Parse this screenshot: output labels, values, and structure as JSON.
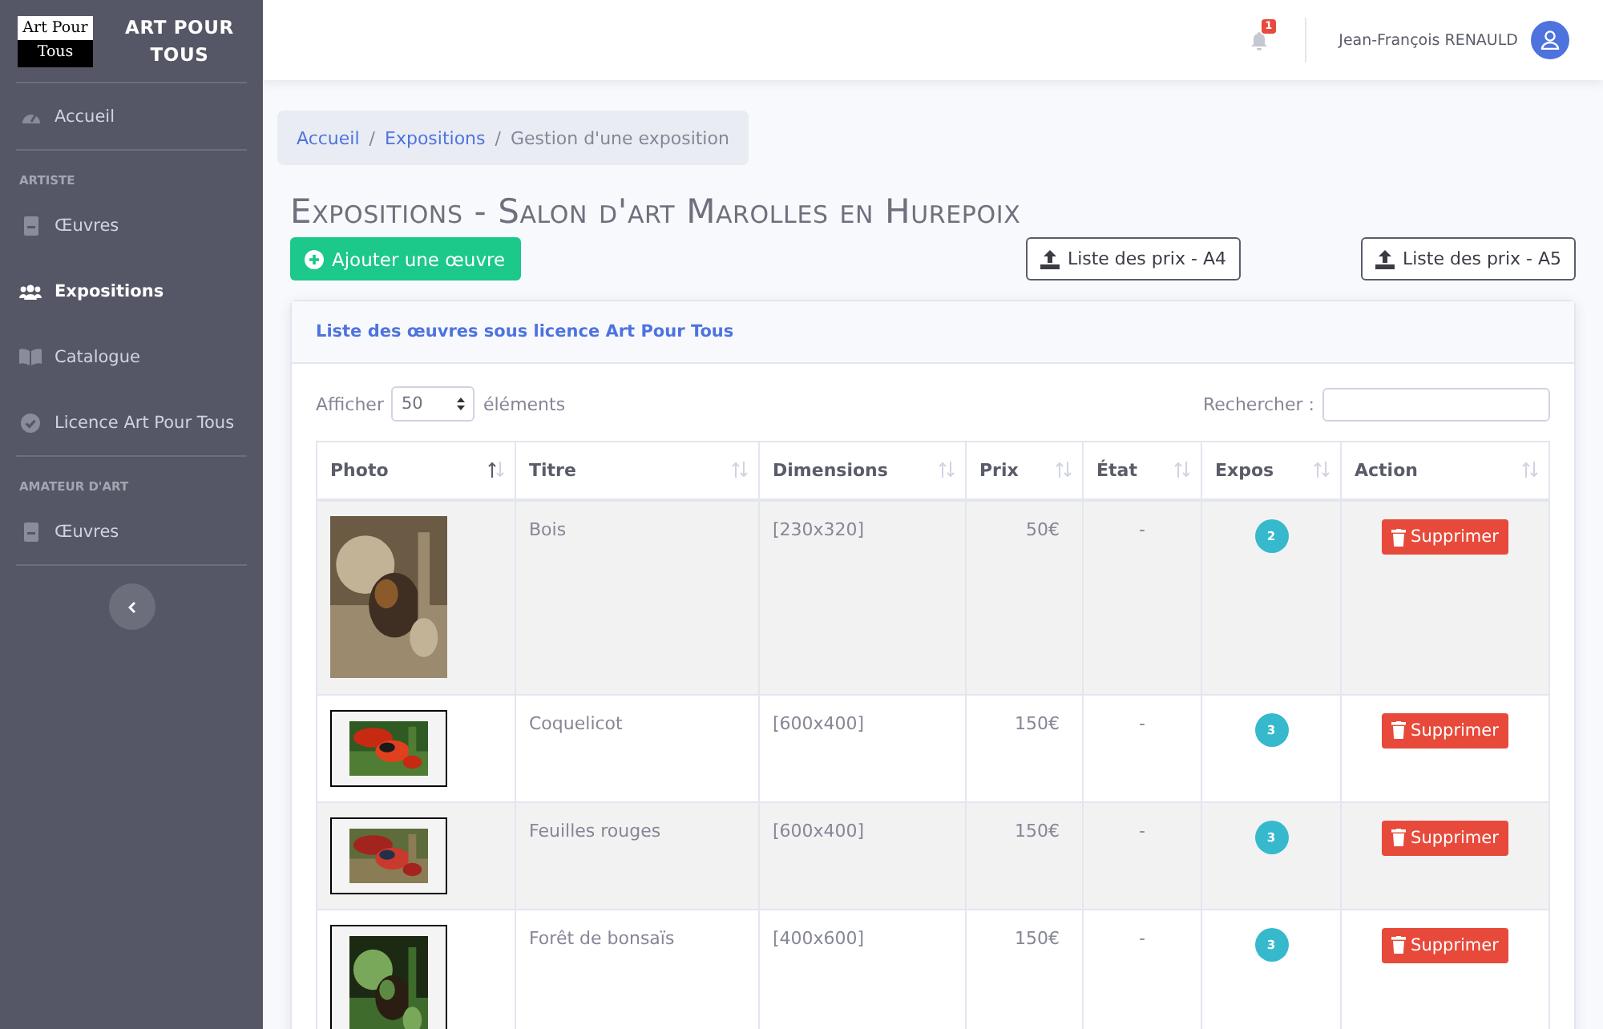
{
  "sidebar": {
    "logo_lines": [
      "Art Pour",
      "Tous"
    ],
    "brand": "ART POUR TOUS",
    "items": [
      {
        "kind": "divider"
      },
      {
        "kind": "link",
        "label": "Accueil",
        "selected": false
      },
      {
        "kind": "divider"
      },
      {
        "kind": "heading",
        "label": "ARTISTE"
      },
      {
        "kind": "link",
        "label": "Œuvres",
        "selected": false
      },
      {
        "kind": "link",
        "label": "Expositions",
        "selected": true
      },
      {
        "kind": "link",
        "label": "Catalogue",
        "selected": false
      },
      {
        "kind": "link",
        "label": "Licence Art Pour Tous",
        "selected": false
      },
      {
        "kind": "divider"
      },
      {
        "kind": "heading",
        "label": "AMATEUR D'ART"
      },
      {
        "kind": "link",
        "label": "Œuvres",
        "selected": false
      },
      {
        "kind": "divider"
      }
    ]
  },
  "topbar": {
    "notification_count": "1",
    "user_name": "Jean-François RENAULD"
  },
  "breadcrumb": [
    {
      "kind": "link",
      "label": "Accueil"
    },
    {
      "kind": "separator",
      "label": "/"
    },
    {
      "kind": "link",
      "label": "Expositions"
    },
    {
      "kind": "separator",
      "label": "/"
    },
    {
      "kind": "current",
      "label": "Gestion d'une exposition"
    }
  ],
  "page_title": "Expositions - Salon d'art Marolles en Hurepoix",
  "actions": {
    "add": "Ajouter une œuvre",
    "exports": [
      "Liste des prix - A4",
      "Liste des prix - A5"
    ]
  },
  "card": {
    "title": "Liste des œuvres sous licence Art Pour Tous",
    "show_label": "Afficher",
    "page_size": "50",
    "show_suffix": "éléments",
    "search_label": "Rechercher :",
    "columns": [
      "Photo",
      "Titre",
      "Dimensions",
      "Prix",
      "État",
      "Expos",
      "Action"
    ],
    "rows": [
      {
        "photo": {
          "kind": "picture",
          "framed": false
        },
        "title": "Bois",
        "dimensions": "[230x320]",
        "price": "50€",
        "state": "-",
        "expos": "2",
        "action": "Supprimer"
      },
      {
        "photo": {
          "kind": "picture",
          "framed": true
        },
        "title": "Coquelicot",
        "dimensions": "[600x400]",
        "price": "150€",
        "state": "-",
        "expos": "3",
        "action": "Supprimer"
      },
      {
        "photo": {
          "kind": "picture",
          "framed": true
        },
        "title": "Feuilles rouges",
        "dimensions": "[600x400]",
        "price": "150€",
        "state": "-",
        "expos": "3",
        "action": "Supprimer"
      },
      {
        "photo": {
          "kind": "picture",
          "framed": true
        },
        "title": "Forêt de bonsaïs",
        "dimensions": "[400x600]",
        "price": "150€",
        "state": "-",
        "expos": "3",
        "action": "Supprimer"
      }
    ]
  }
}
